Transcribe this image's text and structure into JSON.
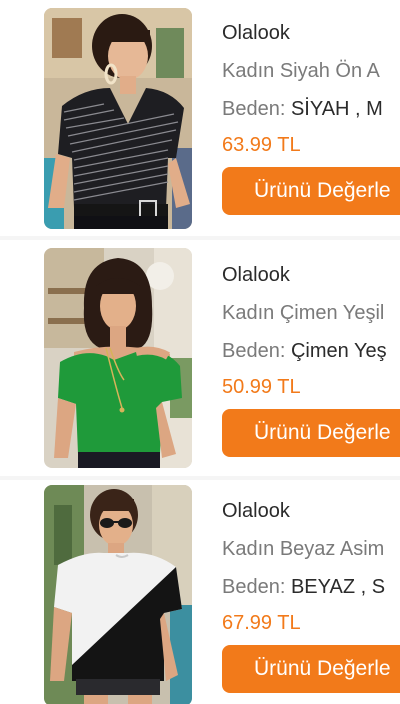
{
  "products": [
    {
      "brand": "Olalook",
      "name": "Kadın Siyah Ön A",
      "size_label": "Beden:",
      "size_value": "SİYAH , M",
      "price": "63.99 TL",
      "button_label": "Ürünü Değerle"
    },
    {
      "brand": "Olalook",
      "name": "Kadın Çimen Yeşil",
      "size_label": "Beden:",
      "size_value": "Çimen Yeş",
      "price": "50.99 TL",
      "button_label": "Ürünü Değerle"
    },
    {
      "brand": "Olalook",
      "name": "Kadın Beyaz Asim",
      "size_label": "Beden:",
      "size_value": "BEYAZ , S",
      "price": "67.99 TL",
      "button_label": "Ürünü Değerle"
    }
  ],
  "colors": {
    "accent": "#f27a1a",
    "text_dark": "#2b2b2b",
    "text_muted": "#7a7a7a"
  }
}
